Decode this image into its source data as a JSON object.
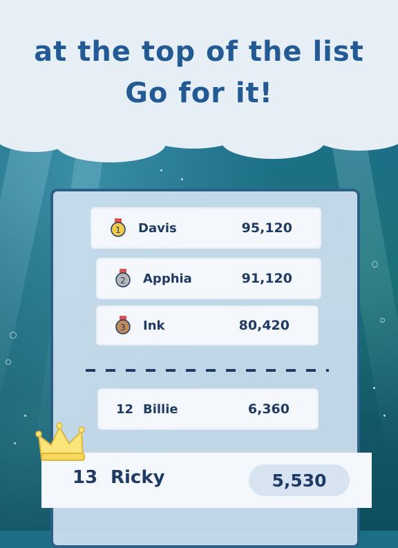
{
  "headline": {
    "line1": "at the top of the list",
    "line2": "Go for it!"
  },
  "leaderboard": {
    "top": [
      {
        "medal": "gold-medal-icon",
        "medal_number": "1",
        "name": "Davis",
        "score": "95,120"
      },
      {
        "medal": "silver-medal-icon",
        "medal_number": "2",
        "name": "Apphia",
        "score": "91,120"
      },
      {
        "medal": "bronze-medal-icon",
        "medal_number": "3",
        "name": "Ink",
        "score": "80,420"
      }
    ],
    "nearby": [
      {
        "rank": "12",
        "name": "Billie",
        "score": "6,360"
      }
    ],
    "current_user": {
      "rank": "13",
      "name": "Ricky",
      "score": "5,530"
    }
  },
  "colors": {
    "text": "#1f3b63",
    "headline": "#245a93",
    "gold": "#f2c94c",
    "silver": "#a9a9a9",
    "bronze": "#c08a5a",
    "medal_ribbon": "#d9534f"
  }
}
